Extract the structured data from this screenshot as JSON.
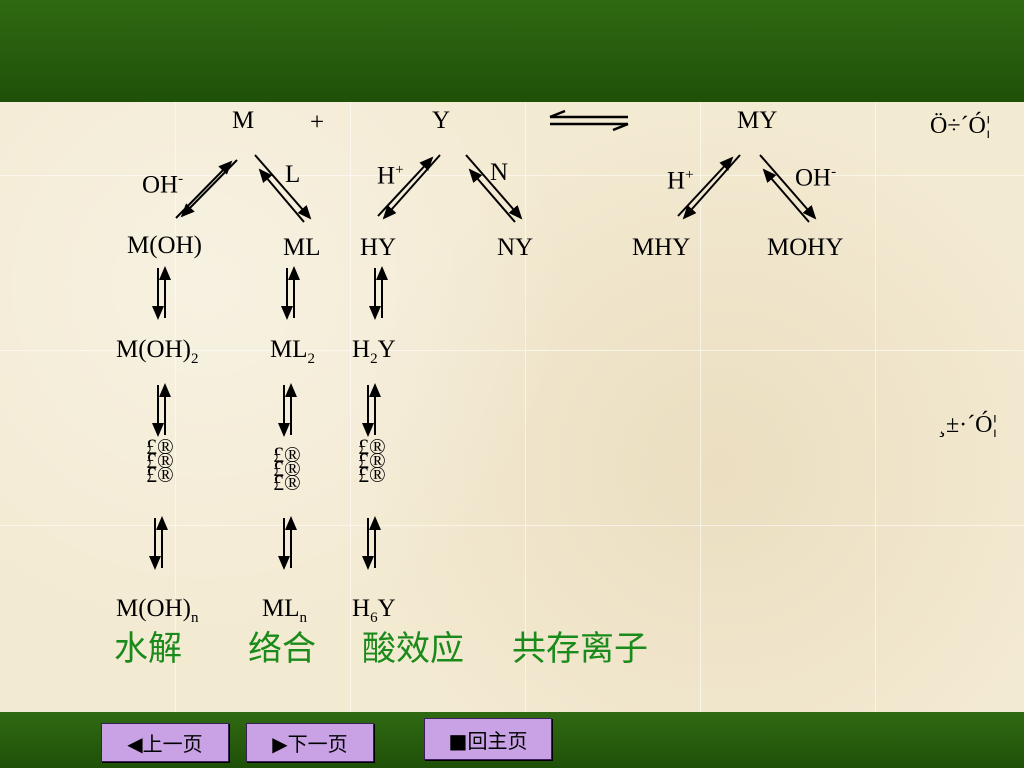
{
  "equation": {
    "m": "M",
    "plus": "+",
    "y": "Y",
    "my": "MY",
    "right_label_1": "Ö÷´Ó¦",
    "right_label_2": "¸±·´Ó¦"
  },
  "reagents": {
    "oh": "OH",
    "oh_sup": "-",
    "l": "L",
    "h": "H",
    "h_sup": "+",
    "n": "N",
    "h2": "H",
    "h2_sup": "+",
    "oh2": "OH",
    "oh2_sup": "-"
  },
  "species_row1": {
    "moh": "M(OH)",
    "ml": "ML",
    "hy": "HY",
    "ny": "NY",
    "mhy": "MHY",
    "mohy": "MOHY"
  },
  "species_row2": {
    "moh2_base": "M(OH)",
    "moh2_sub": "2",
    "ml2_base": "ML",
    "ml2_sub": "2",
    "h2y_pre": "H",
    "h2y_sub": "2",
    "h2y_post": "Y"
  },
  "ellipsis": {
    "col1": "£®\n£®\n£®",
    "col2": "£®\n£®\n£®",
    "col3": "£®\n£®\n£®"
  },
  "species_row3": {
    "mohn_base": "M(OH)",
    "mohn_sub": "n",
    "mln_base": "ML",
    "mln_sub": "n",
    "h6y_pre": "H",
    "h6y_sub": "6",
    "h6y_post": "Y"
  },
  "categories": {
    "hydrolysis": "水解",
    "complexation": "络合",
    "acid_effect": "酸效应",
    "coexisting_ion": "共存离子"
  },
  "nav": {
    "prev": "◀上一页",
    "next": "▶下一页",
    "home": "■回主页"
  },
  "colors": {
    "header": "#2f6a12",
    "category_text": "#1a8a1a",
    "button": "#c9a2e6"
  }
}
